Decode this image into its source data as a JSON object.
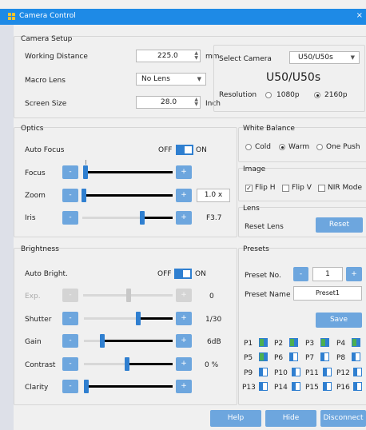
{
  "window": {
    "title": "Camera Control",
    "close": "×"
  },
  "setup": {
    "title": "Camera Setup",
    "working_distance_label": "Working Distance",
    "working_distance_value": "225.0",
    "working_distance_unit": "mm",
    "macro_label": "Macro Lens",
    "macro_value": "No Lens",
    "screen_label": "Screen Size",
    "screen_value": "28.0",
    "screen_unit": "Inch",
    "select_camera_label": "Select Camera",
    "select_camera_value": "U50/U50s",
    "camera_name": "U50/U50s",
    "resolution_label": "Resolution",
    "res_1080": "1080p",
    "res_2160": "2160p"
  },
  "optics": {
    "title": "Optics",
    "autofocus_label": "Auto Focus",
    "off": "OFF",
    "on": "ON",
    "focus_label": "Focus",
    "zoom_label": "Zoom",
    "zoom_value": "1.0 x",
    "iris_label": "Iris",
    "iris_value": "F3.7",
    "minus": "-",
    "plus": "+"
  },
  "white_balance": {
    "title": "White Balance",
    "cold": "Cold",
    "warm": "Warm",
    "one_push": "One Push"
  },
  "image": {
    "title": "Image",
    "flip_h": "Flip H",
    "flip_v": "Flip V",
    "nir": "NIR Mode"
  },
  "lens": {
    "title": "Lens",
    "reset_label": "Reset Lens",
    "reset_button": "Reset"
  },
  "brightness": {
    "title": "Brightness",
    "auto_label": "Auto Bright.",
    "off": "OFF",
    "on": "ON",
    "exp_label": "Exp.",
    "exp_value": "0",
    "shutter_label": "Shutter",
    "shutter_value": "1/30",
    "gain_label": "Gain",
    "gain_value": "6dB",
    "contrast_label": "Contrast",
    "contrast_value": "0 %",
    "clarity_label": "Clarity"
  },
  "presets": {
    "title": "Presets",
    "preset_no_label": "Preset No.",
    "preset_no_value": "1",
    "preset_name_label": "Preset Name",
    "preset_name_value": "Preset1",
    "save": "Save",
    "items": [
      "P1",
      "P2",
      "P3",
      "P4",
      "P5",
      "P6",
      "P7",
      "P8",
      "P9",
      "P10",
      "P11",
      "P12",
      "P13",
      "P14",
      "P15",
      "P16"
    ]
  },
  "footer": {
    "help": "Help",
    "hide": "Hide",
    "disconnect": "Disconnect"
  }
}
